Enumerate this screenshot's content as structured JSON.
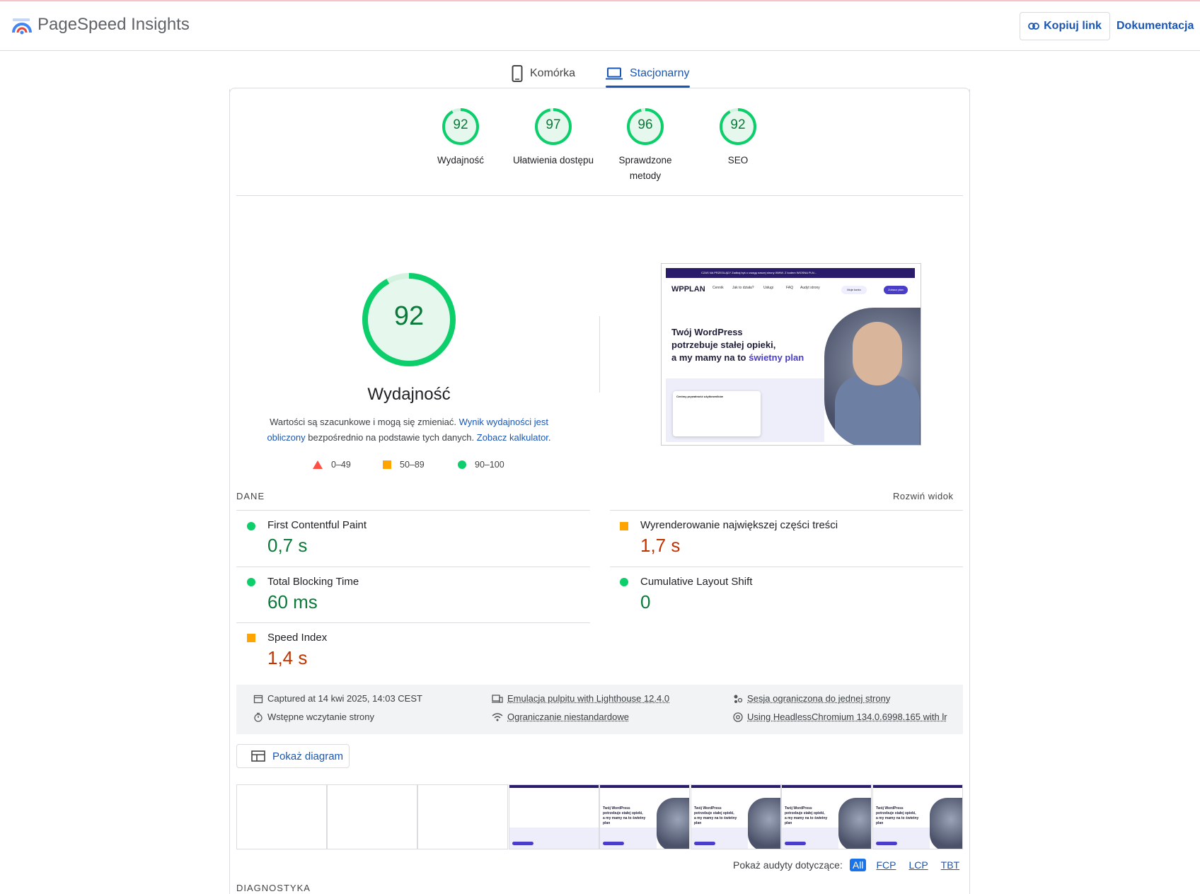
{
  "app": {
    "title": "PageSpeed Insights"
  },
  "header": {
    "copy_link": "Kopiuj link",
    "docs": "Dokumentacja"
  },
  "tabs": [
    {
      "label": "Komórka"
    },
    {
      "label": "Stacjonarny",
      "active": true
    }
  ],
  "scores": [
    {
      "value": 92,
      "label": "Wydajność"
    },
    {
      "value": 97,
      "label": "Ułatwienia dostępu"
    },
    {
      "value": 96,
      "label": "Sprawdzone metody"
    },
    {
      "value": 92,
      "label": "SEO"
    }
  ],
  "performance": {
    "score": 92,
    "title": "Wydajność",
    "desc_1": "Wartości są szacunkowe i mogą się zmieniać. ",
    "desc_link_1": "Wynik wydajności jest obliczony",
    "desc_2": " bezpośrednio na podstawie tych danych. ",
    "desc_link_2": "Zobacz kalkulator",
    "desc_3": ".",
    "legend": [
      {
        "range": "0–49",
        "shape": "triangle",
        "color": "#ff4e42"
      },
      {
        "range": "50–89",
        "shape": "square",
        "color": "#ffa400"
      },
      {
        "range": "90–100",
        "shape": "circle",
        "color": "#0cce6b"
      }
    ]
  },
  "preview": {
    "logo": "WPPLAN",
    "banner": "CZAS NA PRZEGLĄD? Zadbaj byś o uwagę naszej strony WWW. Z kodem WIOSNA PLN...",
    "nav": [
      "Cennik",
      "Jak to działa?",
      "Usługi",
      "FAQ",
      "Audyt strony"
    ],
    "btn_1": "Moje konto",
    "btn_2": "Zobacz plan",
    "headline_1": "Twój WordPress",
    "headline_2": "potrzebuje stałej opieki,",
    "headline_3": "a my mamy na to ",
    "headline_hl": "świetny plan",
    "cookie_title": "Cenimy prywatność użytkowników"
  },
  "metrics_section": {
    "label": "DANE",
    "expand": "Rozwiń widok"
  },
  "metrics": [
    {
      "name": "First Contentful Paint",
      "value": "0,7 s",
      "status": "good"
    },
    {
      "name": "Wyrenderowanie największej części treści",
      "value": "1,7 s",
      "status": "average"
    },
    {
      "name": "Total Blocking Time",
      "value": "60 ms",
      "status": "good"
    },
    {
      "name": "Cumulative Layout Shift",
      "value": "0",
      "status": "good"
    },
    {
      "name": "Speed Index",
      "value": "1,4 s",
      "status": "average"
    }
  ],
  "info": {
    "captured": "Captured at 14 kwi 2025, 14:03 CEST",
    "initial_load": "Wstępne wczytanie strony",
    "emulation": "Emulacja pulpitu with Lighthouse 12.4.0",
    "throttling": "Ograniczanie niestandardowe",
    "session": "Sesja ograniczona do jednej strony",
    "browser": "Using HeadlessChromium 134.0.6998.165 with lr"
  },
  "diagram_button": "Pokaż diagram",
  "filters": {
    "label": "Pokaż audyty dotyczące:",
    "options": [
      "All",
      "FCP",
      "LCP",
      "TBT"
    ]
  },
  "diagnostics": {
    "label": "DIAGNOSTYKA"
  },
  "colors": {
    "accent": "#1a56b4",
    "good": "#0cce6b",
    "average": "#ffa400",
    "poor": "#ff4e42"
  }
}
